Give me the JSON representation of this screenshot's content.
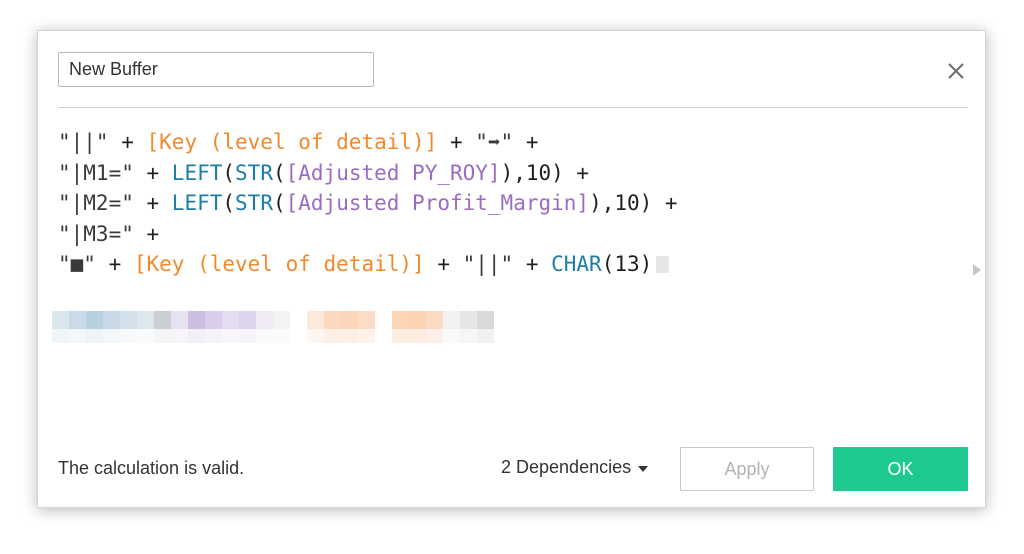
{
  "dialog": {
    "name_value": "New Buffer",
    "close_icon": "close-icon"
  },
  "editor": {
    "lines": [
      [
        {
          "t": "\"||\"",
          "k": "str"
        },
        {
          "t": " + ",
          "k": "op"
        },
        {
          "t": "[Key (level of detail)]",
          "k": "fld-orange"
        },
        {
          "t": " + ",
          "k": "op"
        },
        {
          "t": "\"➡\"",
          "k": "str"
        },
        {
          "t": " +",
          "k": "op"
        }
      ],
      [
        {
          "t": "\"|M1=\"",
          "k": "str"
        },
        {
          "t": " + ",
          "k": "op"
        },
        {
          "t": "LEFT",
          "k": "fn"
        },
        {
          "t": "(",
          "k": "op"
        },
        {
          "t": "STR",
          "k": "fn"
        },
        {
          "t": "(",
          "k": "op"
        },
        {
          "t": "[Adjusted PY_ROY]",
          "k": "fld-purple"
        },
        {
          "t": "),10) +",
          "k": "op"
        }
      ],
      [
        {
          "t": "\"|M2=\"",
          "k": "str"
        },
        {
          "t": " + ",
          "k": "op"
        },
        {
          "t": "LEFT",
          "k": "fn"
        },
        {
          "t": "(",
          "k": "op"
        },
        {
          "t": "STR",
          "k": "fn"
        },
        {
          "t": "(",
          "k": "op"
        },
        {
          "t": "[Adjusted Profit_Margin]",
          "k": "fld-purple"
        },
        {
          "t": "),10) +",
          "k": "op"
        }
      ],
      [
        {
          "t": "\"|M3=\"",
          "k": "str"
        },
        {
          "t": " +",
          "k": "op"
        }
      ],
      [
        {
          "t": "\"■\"",
          "k": "str"
        },
        {
          "t": " + ",
          "k": "op"
        },
        {
          "t": "[Key (level of detail)]",
          "k": "fld-orange"
        },
        {
          "t": " + ",
          "k": "op"
        },
        {
          "t": "\"||\"",
          "k": "str"
        },
        {
          "t": " + ",
          "k": "op"
        },
        {
          "t": "CHAR",
          "k": "fn"
        },
        {
          "t": "(13)",
          "k": "op"
        }
      ]
    ]
  },
  "blurred_colors": {
    "row1": [
      "#d9e6ee",
      "#c9dbe6",
      "#b8d0de",
      "#c7d9e4",
      "#d2e1ea",
      "#dde8ee",
      "#c9cfd3",
      "#e6e2ef",
      "#cdbde3",
      "#d9cdeb",
      "#e4dcf0",
      "#ddd3ec",
      "#efeaf5",
      "#f3f3f3",
      "#ffffff",
      "#fde9db",
      "#fbd8bf",
      "#fbd6bb",
      "#fcdcc5",
      "#ffffff",
      "#fcd4b6",
      "#fbd2b2",
      "#fcd9c0",
      "#f1f1f1",
      "#e6e6e6",
      "#d9d9d9"
    ],
    "row2": [
      "#f0f5f8",
      "#f3f7f9",
      "#eef3f7",
      "#f4f7f9",
      "#f7f9fb",
      "#f9fafb",
      "#f5f5f5",
      "#f7f5fa",
      "#f3eff8",
      "#f6f2fa",
      "#f8f6fb",
      "#f6f3fa",
      "#fafafa",
      "#fafafa",
      "#ffffff",
      "#fef6f0",
      "#fdf0e6",
      "#fdefe4",
      "#fef2ea",
      "#ffffff",
      "#fdeee2",
      "#fdede1",
      "#fef0e8",
      "#fafafa",
      "#f6f6f6",
      "#f1f1f1"
    ]
  },
  "status": {
    "message": "The calculation is valid."
  },
  "footer": {
    "dependencies_label": "2 Dependencies",
    "apply_label": "Apply",
    "ok_label": "OK"
  },
  "colors": {
    "ok_button": "#1ec98e",
    "field_orange": "#f2892b",
    "field_purple": "#9b6cc2",
    "function_blue": "#1b7ea8"
  }
}
